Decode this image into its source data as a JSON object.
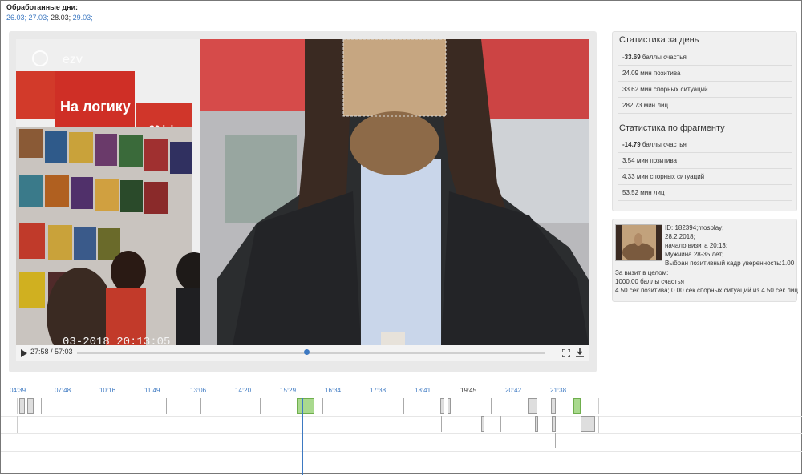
{
  "header": {
    "days_title": "Обработанные дни:",
    "days": [
      {
        "label": "26.03;",
        "current": false
      },
      {
        "label": "27.03;",
        "current": false
      },
      {
        "label": "28.03;",
        "current": true
      },
      {
        "label": "29.03;",
        "current": false
      }
    ]
  },
  "video": {
    "watermark": "ezv",
    "store_sign": "На логику",
    "store_sign2": "80 lvl",
    "timestamp_overlay": "03-2018 20:13:05",
    "time": "27:58 / 57:03",
    "progress_fraction": 0.49
  },
  "day_stats": {
    "title": "Статистика за день",
    "rows": [
      {
        "value": "-33.69",
        "label": "баллы счастья",
        "bold": true
      },
      {
        "value": "24.09",
        "label": "мин позитива",
        "bold": false
      },
      {
        "value": "33.62",
        "label": "мин спорных ситуаций",
        "bold": false
      },
      {
        "value": "282.73",
        "label": "мин лиц",
        "bold": false
      }
    ]
  },
  "fragment_stats": {
    "title": "Статистика по фрагменту",
    "rows": [
      {
        "value": "-14.79",
        "label": "баллы счастья",
        "bold": true
      },
      {
        "value": "3.54",
        "label": "мин позитива",
        "bold": false
      },
      {
        "value": "4.33",
        "label": "мин спорных ситуаций",
        "bold": false
      },
      {
        "value": "53.52",
        "label": "мин лиц",
        "bold": false
      }
    ]
  },
  "visit": {
    "lines": [
      "ID: 182394;mosplay;",
      "28.2.2018;",
      "начало визита 20:13;",
      "Мужчина 28-35 лет;",
      "Выбран позитивный кадр уверенность:1.00"
    ],
    "summary": [
      "За визит в целом:",
      "1000.00 баллы счастья",
      "4.50 сек позитива; 0.00 сек спорных ситуаций из 4.50 сек лиц"
    ]
  },
  "timeline": {
    "labels": [
      "04:39",
      "07:48",
      "10:16",
      "11:49",
      "13:06",
      "14:20",
      "15:29",
      "16:34",
      "17:38",
      "18:41",
      "19:45",
      "20:42",
      "21:38"
    ],
    "active_label_index": 10
  }
}
